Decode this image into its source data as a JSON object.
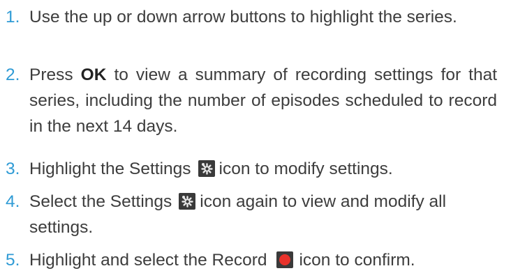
{
  "steps": [
    {
      "number": "1.",
      "text_a": "Use the up or down arrow buttons to highlight the series."
    },
    {
      "number": "2.",
      "text_a": "Press ",
      "bold": "OK",
      "text_b": " to view a summary of recording settings for that series, including the number of episodes scheduled to record in the next 14 days."
    },
    {
      "number": "3.",
      "text_a": "Highlight the Settings",
      "icon": "settings-icon",
      "text_b": "icon to modify settings."
    },
    {
      "number": "4.",
      "text_a": "Select the Settings",
      "icon": "settings-icon",
      "text_b": "icon again to view and modify all settings."
    },
    {
      "number": "5.",
      "text_a": "Highlight and select the Record",
      "icon": "record-icon",
      "text_b": "icon to confirm."
    }
  ],
  "colors": {
    "number": "#2f9bd5",
    "text": "#3d3d3d",
    "settings_icon_bg": "#3a3a3a",
    "record_icon": "#e8322b"
  }
}
